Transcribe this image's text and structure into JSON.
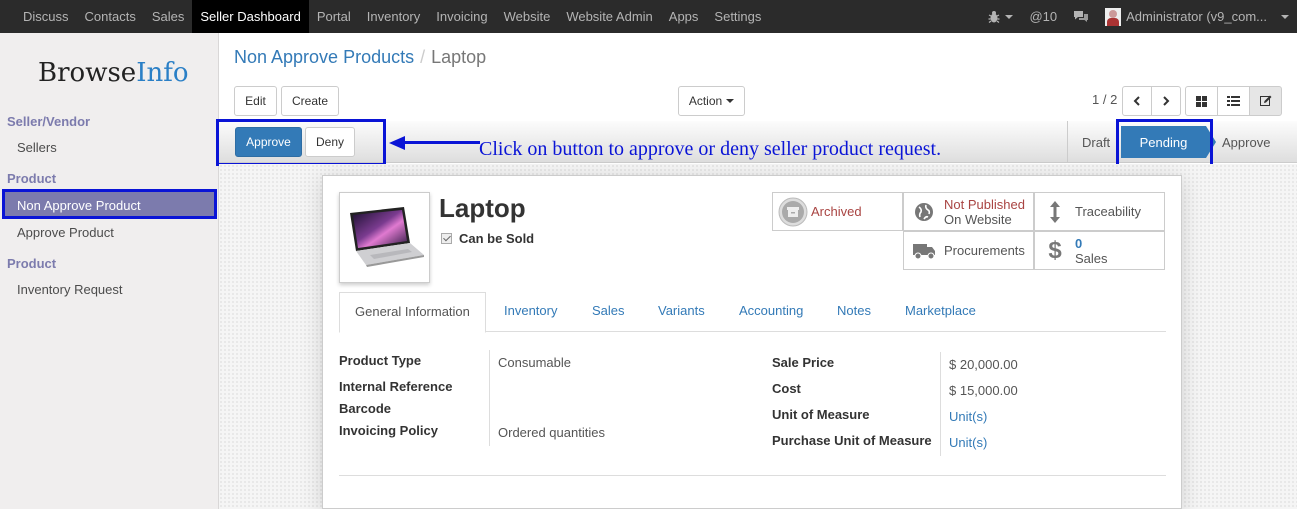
{
  "topbar": {
    "menu": [
      "Discuss",
      "Contacts",
      "Sales",
      "Seller Dashboard",
      "Portal",
      "Inventory",
      "Invoicing",
      "Website",
      "Website Admin",
      "Apps",
      "Settings"
    ],
    "active_menu": "Seller Dashboard",
    "messages_count": "@10",
    "user": "Administrator (v9_com..."
  },
  "sidebar": {
    "logo_part1": "Browse",
    "logo_part2": "Info",
    "section1": "Seller/Vendor",
    "sellers": "Sellers",
    "section2": "Product",
    "non_approve": "Non Approve Product",
    "approve": "Approve Product",
    "section3": "Product",
    "inventory_request": "Inventory Request"
  },
  "breadcrumb": {
    "parent": "Non Approve Products",
    "sep": "/",
    "current": "Laptop"
  },
  "toolbar": {
    "edit": "Edit",
    "create": "Create",
    "action": "Action",
    "pager": "1 / 2"
  },
  "statusbar": {
    "approve_btn": "Approve",
    "deny_btn": "Deny",
    "annotation": "Click on button to approve or deny seller product request.",
    "stages": [
      "Draft",
      "Pending",
      "Approve"
    ],
    "current_stage": "Pending"
  },
  "product": {
    "name": "Laptop",
    "can_be_sold": "Can be Sold",
    "smart_buttons": {
      "archived": "Archived",
      "not_published": "Not Published",
      "on_website": "On Website",
      "traceability": "Traceability",
      "procurements": "Procurements",
      "sales_count": "0",
      "sales_label": "Sales"
    },
    "tabs": [
      "General Information",
      "Inventory",
      "Sales",
      "Variants",
      "Accounting",
      "Notes",
      "Marketplace"
    ],
    "fields_left": {
      "product_type_label": "Product Type",
      "product_type": "Consumable",
      "internal_ref_label": "Internal Reference",
      "barcode_label": "Barcode",
      "invoicing_policy_label": "Invoicing Policy",
      "invoicing_policy": "Ordered quantities"
    },
    "fields_right": {
      "sale_price_label": "Sale Price",
      "sale_price": "$ 20,000.00",
      "cost_label": "Cost",
      "cost": "$ 15,000.00",
      "uom_label": "Unit of Measure",
      "uom": "Unit(s)",
      "purchase_uom_label": "Purchase Unit of Measure",
      "purchase_uom": "Unit(s)"
    }
  },
  "colors": {
    "accent": "#337ab7",
    "highlight": "#0a14d6",
    "sidebar_active": "#7c7bad",
    "archived": "#a94442"
  }
}
